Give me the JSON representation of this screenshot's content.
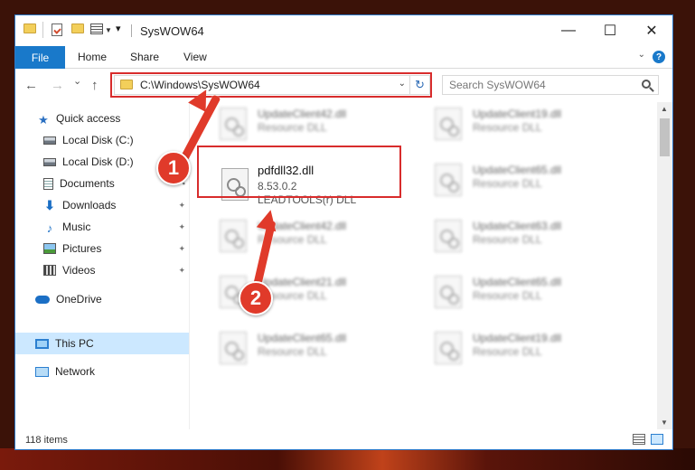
{
  "window": {
    "title": "SysWOW64",
    "minimize": "—",
    "maximize": "☐",
    "close": "✕"
  },
  "ribbon": {
    "tabs": [
      "File",
      "Home",
      "Share",
      "View"
    ],
    "help": "?"
  },
  "nav": {
    "back": "←",
    "forward": "→",
    "recent": "⌄",
    "up": "↑",
    "address": "C:\\Windows\\SysWOW64",
    "refresh": "↻",
    "search_placeholder": "Search SysWOW64"
  },
  "sidebar": {
    "items": [
      {
        "label": "Quick access",
        "icon": "star-icon"
      },
      {
        "label": "Local Disk (C:)",
        "icon": "drive-icon"
      },
      {
        "label": "Local Disk (D:)",
        "icon": "drive-icon"
      },
      {
        "label": "Documents",
        "icon": "documents-icon",
        "pinned": true
      },
      {
        "label": "Downloads",
        "icon": "download-icon",
        "pinned": true
      },
      {
        "label": "Music",
        "icon": "music-icon",
        "pinned": true
      },
      {
        "label": "Pictures",
        "icon": "pictures-icon",
        "pinned": true
      },
      {
        "label": "Videos",
        "icon": "videos-icon",
        "pinned": true
      },
      {
        "label": "OneDrive",
        "icon": "cloud-icon"
      },
      {
        "label": "This PC",
        "icon": "computer-icon",
        "selected": true
      },
      {
        "label": "Network",
        "icon": "network-icon"
      }
    ],
    "pin_glyph": "📌"
  },
  "files": [
    {
      "name": "UpdateClient42.dll",
      "type": "Resource DLL"
    },
    {
      "name": "UpdateClient19.dll",
      "type": "Resource DLL"
    },
    {
      "name": "pdfdll32.dll",
      "version": "8.53.0.2",
      "type": "LEADTOOLS(r) DLL"
    },
    {
      "name": "UpdateClient65.dll",
      "type": "Resource DLL"
    },
    {
      "name": "UpdateClient42.dll",
      "type": "Resource DLL"
    },
    {
      "name": "UpdateClient63.dll",
      "type": "Resource DLL"
    },
    {
      "name": "UpdateClient21.dll",
      "type": "Resource DLL"
    },
    {
      "name": "UpdateClient65.dll",
      "type": "Resource DLL"
    },
    {
      "name": "UpdateClient65.dll",
      "type": "Resource DLL"
    },
    {
      "name": "UpdateClient19.dll",
      "type": "Resource DLL"
    }
  ],
  "status": {
    "items_count": "118 items"
  },
  "annotations": {
    "badge1": "1",
    "badge2": "2",
    "color": "#e03a2a"
  }
}
